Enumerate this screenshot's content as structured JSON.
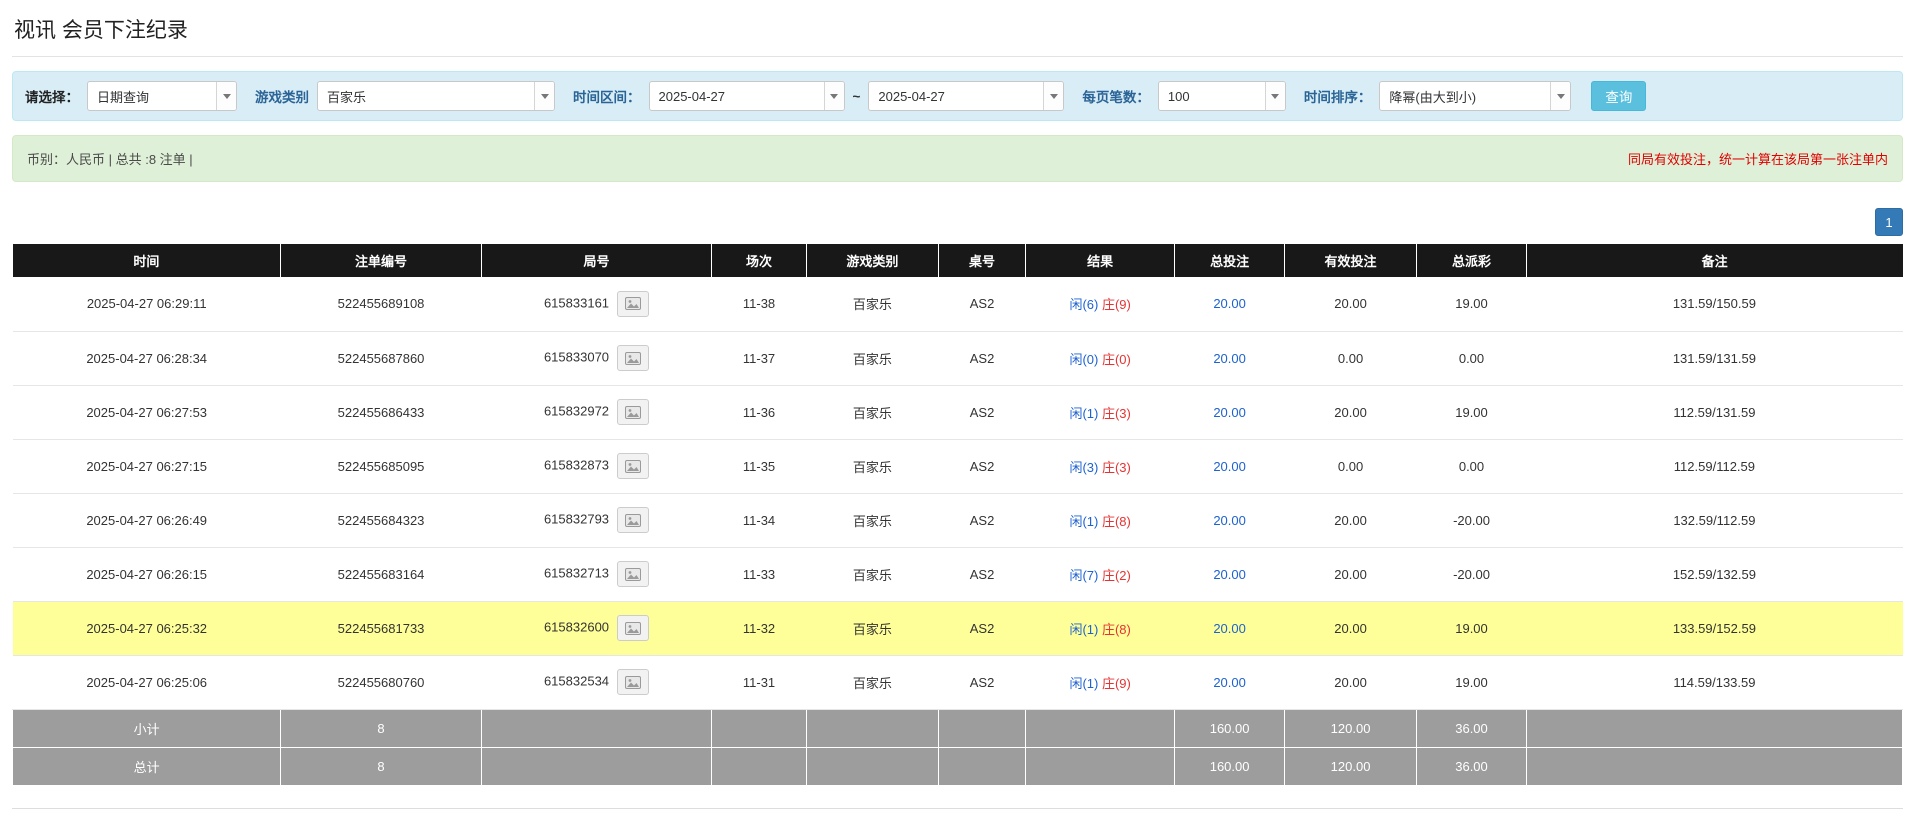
{
  "page": {
    "title": "视讯 会员下注纪录"
  },
  "filters": {
    "select_label": "请选择：",
    "select_value": "日期查询",
    "game_type_label": "游戏类别",
    "game_type_value": "百家乐",
    "time_range_label": "时间区间：",
    "date_from": "2025-04-27",
    "tilde": "~",
    "date_to": "2025-04-27",
    "page_size_label": "每页笔数：",
    "page_size_value": "100",
    "sort_label": "时间排序：",
    "sort_value": "降幂(由大到小)",
    "search_button": "查询"
  },
  "summary": {
    "left": "币别：人民币 | 总共 :8 注单 |",
    "right": "同局有效投注，统一计算在该局第一张注单内"
  },
  "pagination": {
    "current_page": "1"
  },
  "colors": {
    "accent_blue": "#337ab7",
    "player_blue": "#1e62d0",
    "banker_red": "#e53333",
    "notice_red": "#e00000",
    "highlight_yellow": "#ffff99"
  },
  "table": {
    "headers": [
      "时间",
      "注单编号",
      "局号",
      "场次",
      "游戏类别",
      "桌号",
      "结果",
      "总投注",
      "有效投注",
      "总派彩",
      "备注"
    ],
    "rows": [
      {
        "time": "2025-04-27 06:29:11",
        "bet_id": "522455689108",
        "round_id": "615833161",
        "session": "11-38",
        "game": "百家乐",
        "table_no": "AS2",
        "result_player": "闲(6)",
        "result_banker": "庄(9)",
        "total_bet": "20.00",
        "valid_bet": "20.00",
        "payout": "19.00",
        "payout_negative": false,
        "note": "131.59/150.59",
        "highlighted": false
      },
      {
        "time": "2025-04-27 06:28:34",
        "bet_id": "522455687860",
        "round_id": "615833070",
        "session": "11-37",
        "game": "百家乐",
        "table_no": "AS2",
        "result_player": "闲(0)",
        "result_banker": "庄(0)",
        "total_bet": "20.00",
        "valid_bet": "0.00",
        "payout": "0.00",
        "payout_negative": false,
        "note": "131.59/131.59",
        "highlighted": false
      },
      {
        "time": "2025-04-27 06:27:53",
        "bet_id": "522455686433",
        "round_id": "615832972",
        "session": "11-36",
        "game": "百家乐",
        "table_no": "AS2",
        "result_player": "闲(1)",
        "result_banker": "庄(3)",
        "total_bet": "20.00",
        "valid_bet": "20.00",
        "payout": "19.00",
        "payout_negative": false,
        "note": "112.59/131.59",
        "highlighted": false
      },
      {
        "time": "2025-04-27 06:27:15",
        "bet_id": "522455685095",
        "round_id": "615832873",
        "session": "11-35",
        "game": "百家乐",
        "table_no": "AS2",
        "result_player": "闲(3)",
        "result_banker": "庄(3)",
        "total_bet": "20.00",
        "valid_bet": "0.00",
        "payout": "0.00",
        "payout_negative": false,
        "note": "112.59/112.59",
        "highlighted": false
      },
      {
        "time": "2025-04-27 06:26:49",
        "bet_id": "522455684323",
        "round_id": "615832793",
        "session": "11-34",
        "game": "百家乐",
        "table_no": "AS2",
        "result_player": "闲(1)",
        "result_banker": "庄(8)",
        "total_bet": "20.00",
        "valid_bet": "20.00",
        "payout": "-20.00",
        "payout_negative": true,
        "note": "132.59/112.59",
        "highlighted": false
      },
      {
        "time": "2025-04-27 06:26:15",
        "bet_id": "522455683164",
        "round_id": "615832713",
        "session": "11-33",
        "game": "百家乐",
        "table_no": "AS2",
        "result_player": "闲(7)",
        "result_banker": "庄(2)",
        "total_bet": "20.00",
        "valid_bet": "20.00",
        "payout": "-20.00",
        "payout_negative": true,
        "note": "152.59/132.59",
        "highlighted": false
      },
      {
        "time": "2025-04-27 06:25:32",
        "bet_id": "522455681733",
        "round_id": "615832600",
        "session": "11-32",
        "game": "百家乐",
        "table_no": "AS2",
        "result_player": "闲(1)",
        "result_banker": "庄(8)",
        "total_bet": "20.00",
        "valid_bet": "20.00",
        "payout": "19.00",
        "payout_negative": false,
        "note": "133.59/152.59",
        "highlighted": true
      },
      {
        "time": "2025-04-27 06:25:06",
        "bet_id": "522455680760",
        "round_id": "615832534",
        "session": "11-31",
        "game": "百家乐",
        "table_no": "AS2",
        "result_player": "闲(1)",
        "result_banker": "庄(9)",
        "total_bet": "20.00",
        "valid_bet": "20.00",
        "payout": "19.00",
        "payout_negative": false,
        "note": "114.59/133.59",
        "highlighted": false
      }
    ],
    "subtotal": {
      "label": "小计",
      "count": "8",
      "total_bet": "160.00",
      "valid_bet": "120.00",
      "payout": "36.00"
    },
    "total": {
      "label": "总计",
      "count": "8",
      "total_bet": "160.00",
      "valid_bet": "120.00",
      "payout": "36.00"
    }
  }
}
